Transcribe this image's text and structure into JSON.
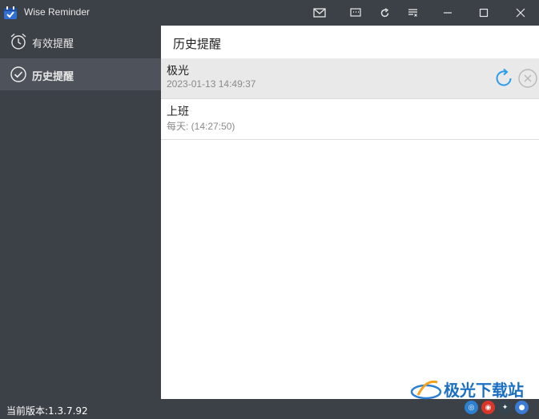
{
  "window": {
    "title": "Wise Reminder",
    "toolbar_icons": [
      "mail-icon",
      "message-icon",
      "refresh-icon",
      "list-settings-icon"
    ],
    "controls": [
      "minimize-icon",
      "maximize-icon",
      "close-icon"
    ]
  },
  "sidebar": {
    "items": [
      {
        "label": "有效提醒",
        "icon": "alarm-clock-icon",
        "active": false
      },
      {
        "label": "历史提醒",
        "icon": "check-circle-icon",
        "active": true
      }
    ]
  },
  "main": {
    "title": "历史提醒",
    "reminders": [
      {
        "name": "极光",
        "time": "2023-01-13 14:49:37",
        "selected": true
      },
      {
        "name": "上班",
        "time": "每天: (14:27:50)",
        "selected": false
      }
    ]
  },
  "footer": {
    "version": "当前版本:1.3.7.92"
  },
  "watermark": {
    "text": "极光下载站"
  },
  "colors": {
    "sidebar_bg": "#3c4047",
    "active_bg": "#4e535b",
    "accent": "#2e9ee8"
  }
}
